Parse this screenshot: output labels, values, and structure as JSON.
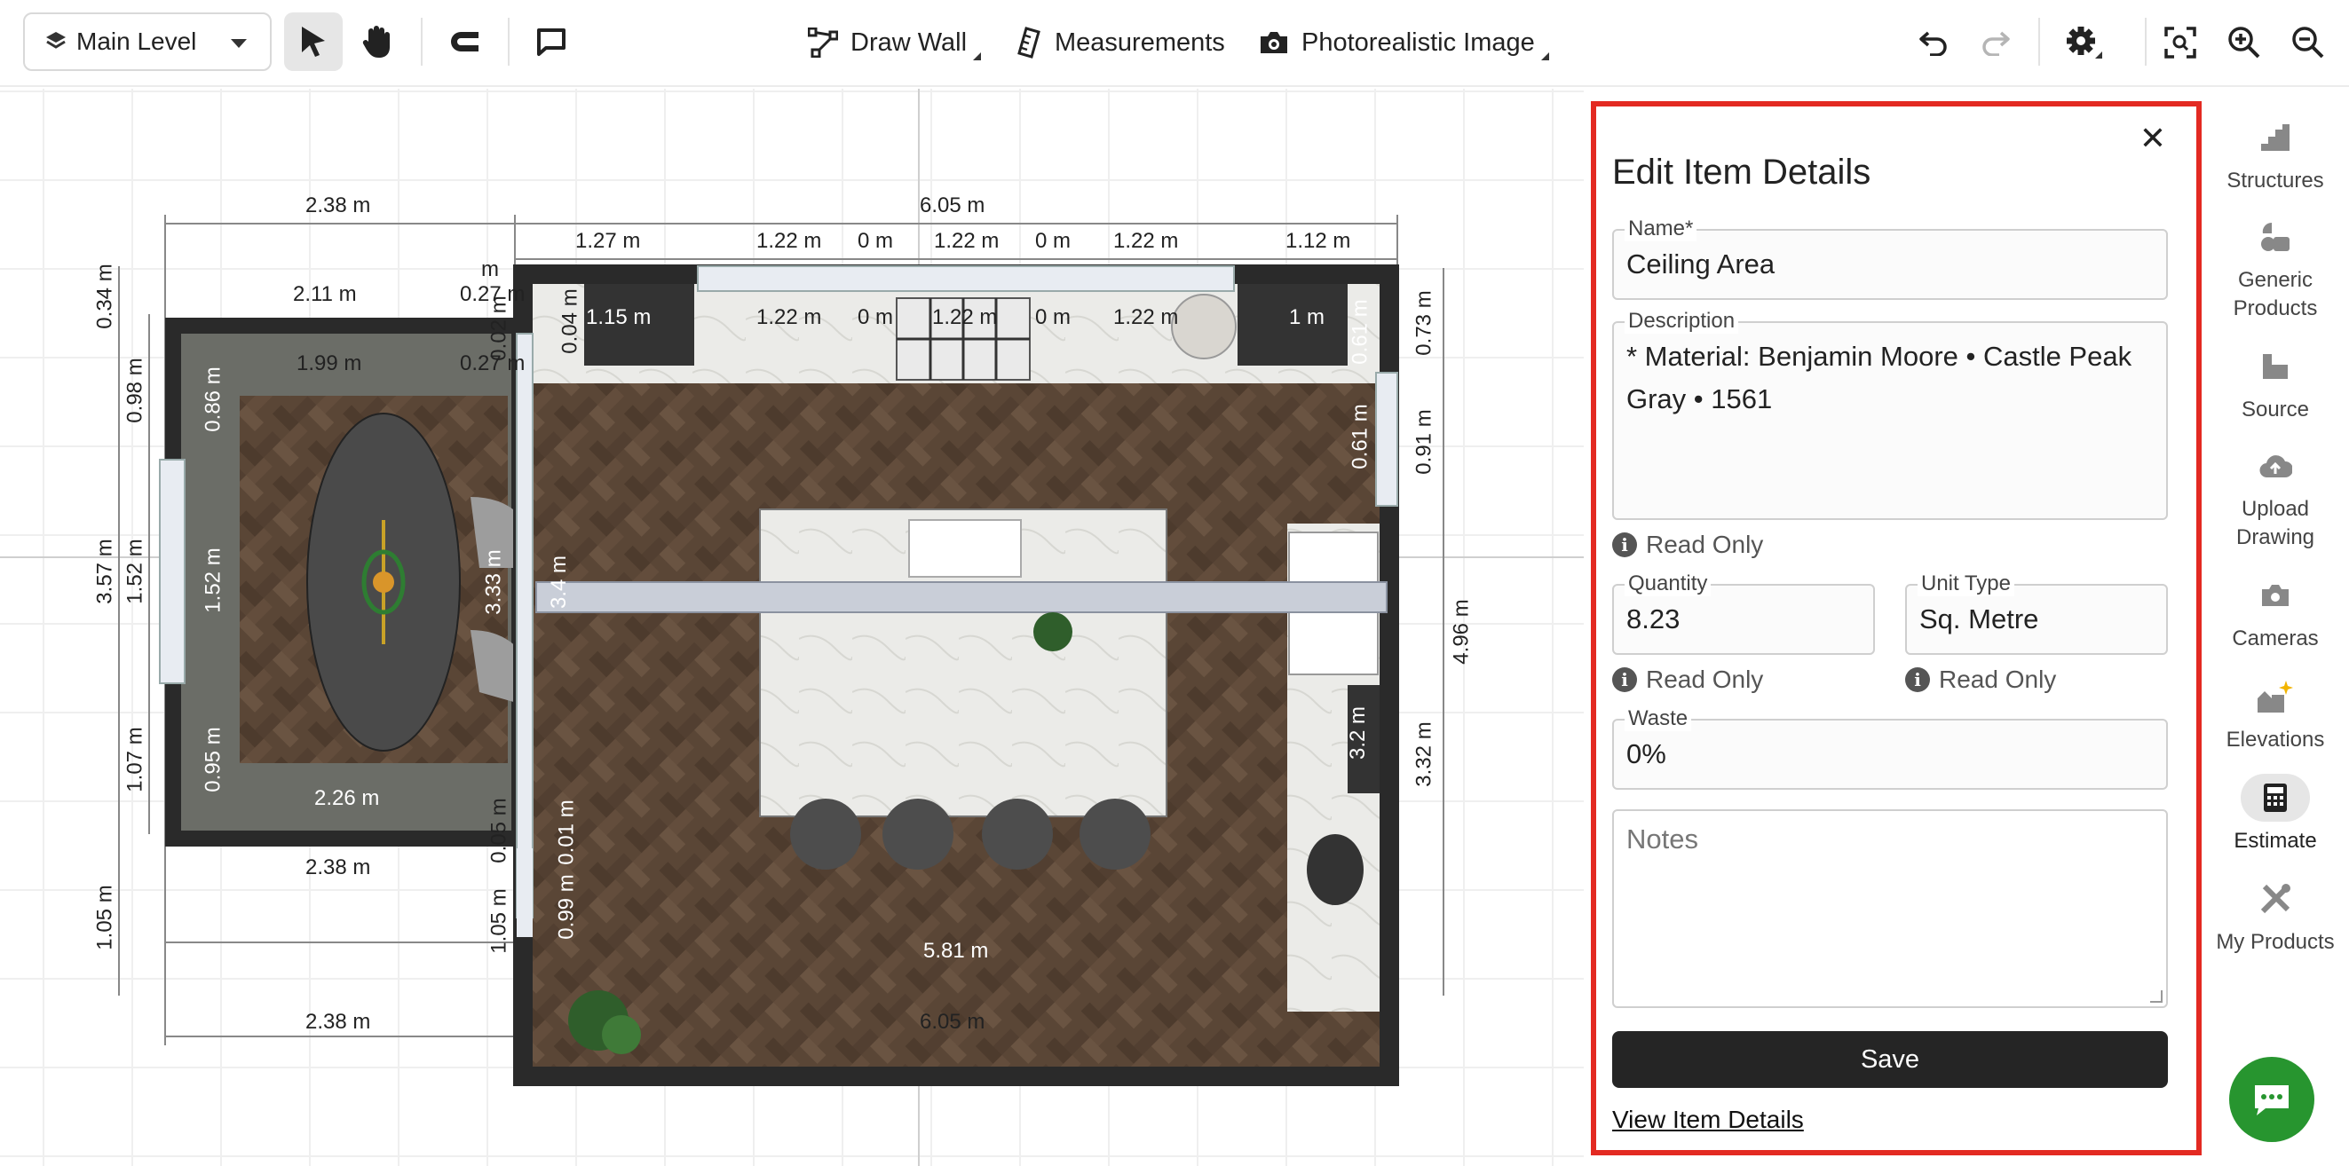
{
  "toolbar": {
    "level_label": "Main Level",
    "draw_wall_label": "Draw Wall",
    "measurements_label": "Measurements",
    "photo_label": "Photorealistic Image"
  },
  "canvas": {
    "dims": {
      "top_left_width": "2.38 m",
      "top_main_width": "6.05 m",
      "seg_1_27": "1.27 m",
      "seg_1_22a": "1.22 m",
      "seg_0a": "0 m",
      "seg_1_22b": "1.22 m",
      "seg_0b": "0 m",
      "seg_1_22c": "1.22 m",
      "seg_1_12": "1.12 m",
      "small_m": "m",
      "inner_2_11": "2.11 m",
      "inner_0_27a": "0.27 m",
      "inner_0_27b": "0.27 m",
      "inner_1_99": "1.99 m",
      "in_1_15": "1.15 m",
      "in_1_22a": "1.22 m",
      "in_0a": "0 m",
      "in_1_22b": "1.22 m",
      "in_0b": "0 m",
      "in_1_22c": "1.22 m",
      "in_1": "1 m",
      "in_0_61a": "0.61 m",
      "in_0_61b": "0.61 m",
      "in_0_04": "0.04 m",
      "in_0_02": "0.02 m",
      "left_0_34": "0.34 m",
      "left_0_98": "0.98 m",
      "left_3_57": "3.57 m",
      "left_1_52": "1.52 m",
      "left_1_07": "1.07 m",
      "left_1_05": "1.05 m",
      "dining_0_86": "0.86 m",
      "dining_1_52": "1.52 m",
      "dining_0_95": "0.95 m",
      "dining_3_33": "3.33 m",
      "kitchen_3_4": "3.4 m",
      "right_0_73": "0.73 m",
      "right_0_91": "0.91 m",
      "right_4_96": "4.96 m",
      "right_3_32": "3.32 m",
      "in_3_2": "3.2 m",
      "dining_2_26": "2.26 m",
      "bottom_2_38a": "2.38 m",
      "bottom_0_05": "0.05 m",
      "bottom_1_05": "1.05 m",
      "bottom_0_01": "0.01 m",
      "bottom_0_99": "0.99 m",
      "bottom_5_81": "5.81 m",
      "bottom_2_38b": "2.38 m",
      "bottom_6_05": "6.05 m"
    }
  },
  "panel": {
    "title": "Edit Item Details",
    "name_label": "Name*",
    "name_value": "Ceiling Area",
    "description_label": "Description",
    "description_value": "* Material: Benjamin Moore • Castle Peak Gray • 1561",
    "read_only": "Read Only",
    "quantity_label": "Quantity",
    "quantity_value": "8.23",
    "unit_label": "Unit Type",
    "unit_value": "Sq. Metre",
    "waste_label": "Waste",
    "waste_value": "0%",
    "notes_placeholder": "Notes",
    "save_label": "Save",
    "view_link": "View Item Details"
  },
  "sidebar": {
    "structures": "Structures",
    "generic_products": "Generic Products",
    "source": "Source",
    "upload_drawing": "Upload Drawing",
    "cameras": "Cameras",
    "elevations": "Elevations",
    "estimate": "Estimate",
    "my_products": "My Products"
  },
  "colors": {
    "accent_red": "#e32a22",
    "chat_green": "#27952f",
    "floor_wood": "#5a4636",
    "wall_dark": "#2a2a2a"
  }
}
